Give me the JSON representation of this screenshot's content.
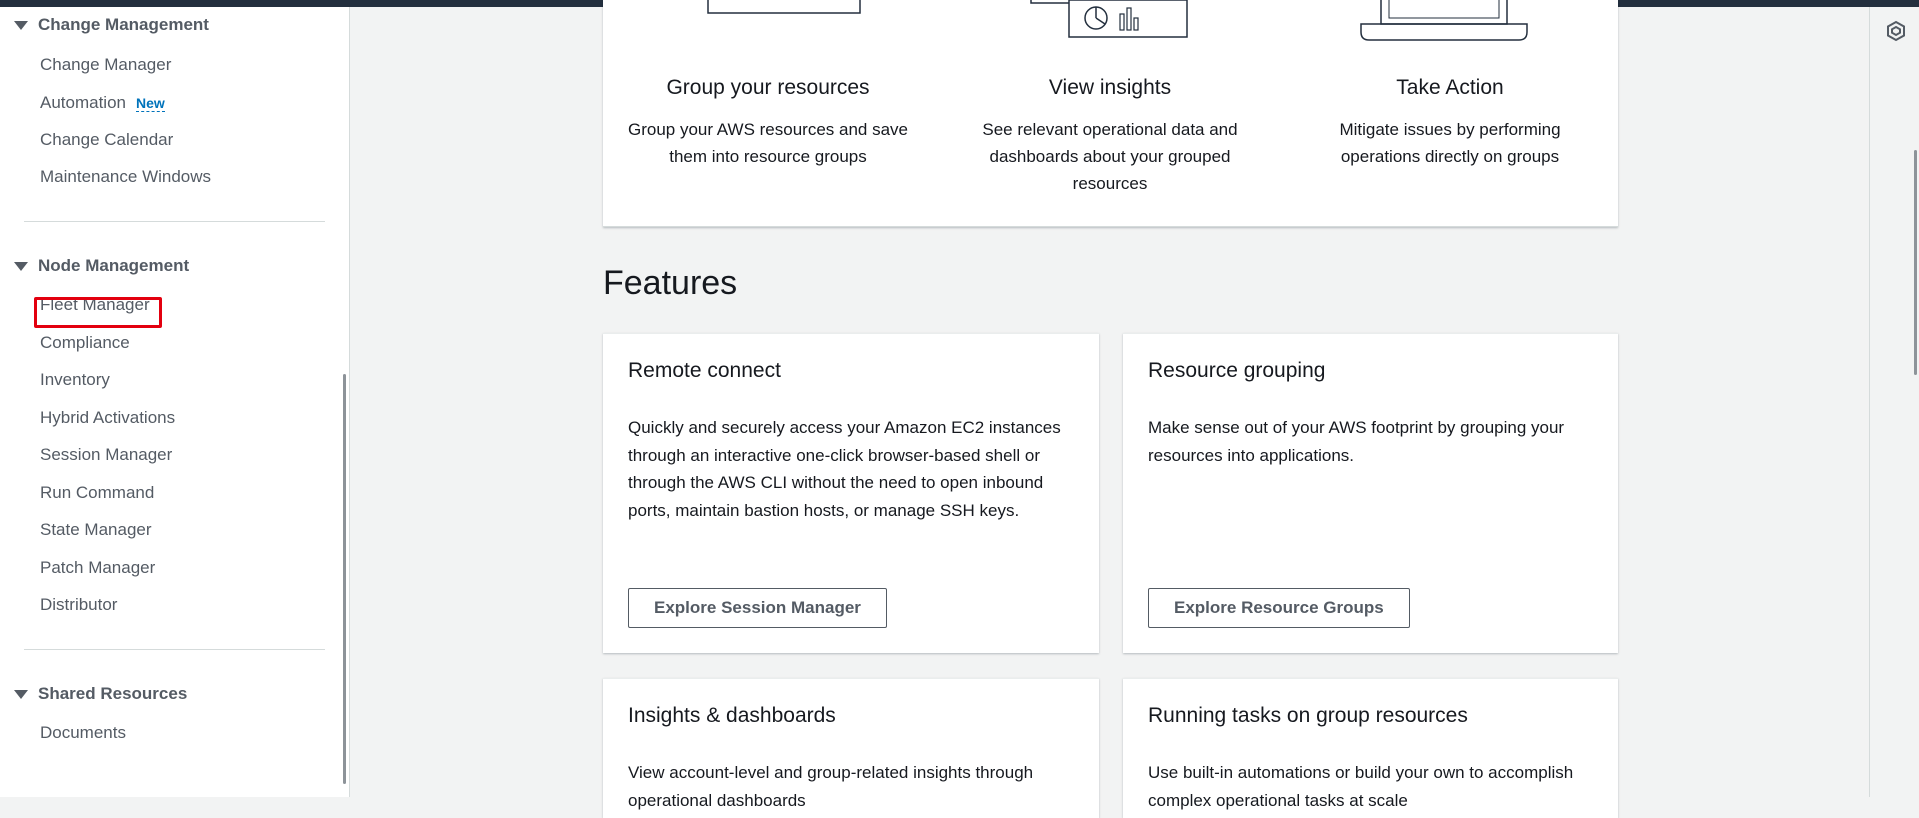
{
  "sidebar": {
    "sections": [
      {
        "header": "Change Management",
        "items": [
          {
            "label": "Change Manager"
          },
          {
            "label": "Automation",
            "badge": "New"
          },
          {
            "label": "Change Calendar"
          },
          {
            "label": "Maintenance Windows"
          }
        ]
      },
      {
        "header": "Node Management",
        "items": [
          {
            "label": "Fleet Manager"
          },
          {
            "label": "Compliance"
          },
          {
            "label": "Inventory"
          },
          {
            "label": "Hybrid Activations"
          },
          {
            "label": "Session Manager"
          },
          {
            "label": "Run Command"
          },
          {
            "label": "State Manager"
          },
          {
            "label": "Patch Manager"
          },
          {
            "label": "Distributor"
          }
        ]
      },
      {
        "header": "Shared Resources",
        "items": [
          {
            "label": "Documents"
          }
        ]
      }
    ]
  },
  "how_it_works": {
    "steps": [
      {
        "title": "Group your resources",
        "description": "Group your AWS resources and save them into resource groups"
      },
      {
        "title": "View insights",
        "description": "See relevant operational data and dashboards about your grouped resources"
      },
      {
        "title": "Take Action",
        "description": "Mitigate issues by performing operations directly on groups"
      }
    ]
  },
  "features": {
    "title": "Features",
    "cards": [
      {
        "title": "Remote connect",
        "description": "Quickly and securely access your Amazon EC2 instances through an interactive one-click browser-based shell or through the AWS CLI without the need to open inbound ports, maintain bastion hosts, or manage SSH keys.",
        "button": "Explore Session Manager"
      },
      {
        "title": "Resource grouping",
        "description": "Make sense out of your AWS footprint by grouping your resources into applications.",
        "button": "Explore Resource Groups"
      },
      {
        "title": "Insights & dashboards",
        "description": "View account-level and group-related insights through operational dashboards"
      },
      {
        "title": "Running tasks on group resources",
        "description": "Use built-in automations or build your own to accomplish complex operational tasks at scale"
      }
    ]
  },
  "colors": {
    "accent_link": "#0073bb",
    "highlight_box": "#e3000f",
    "topbar": "#232f3e"
  },
  "icons": {
    "right_panel": "settings-hexagon-icon",
    "section_toggle": "caret-down-icon"
  }
}
